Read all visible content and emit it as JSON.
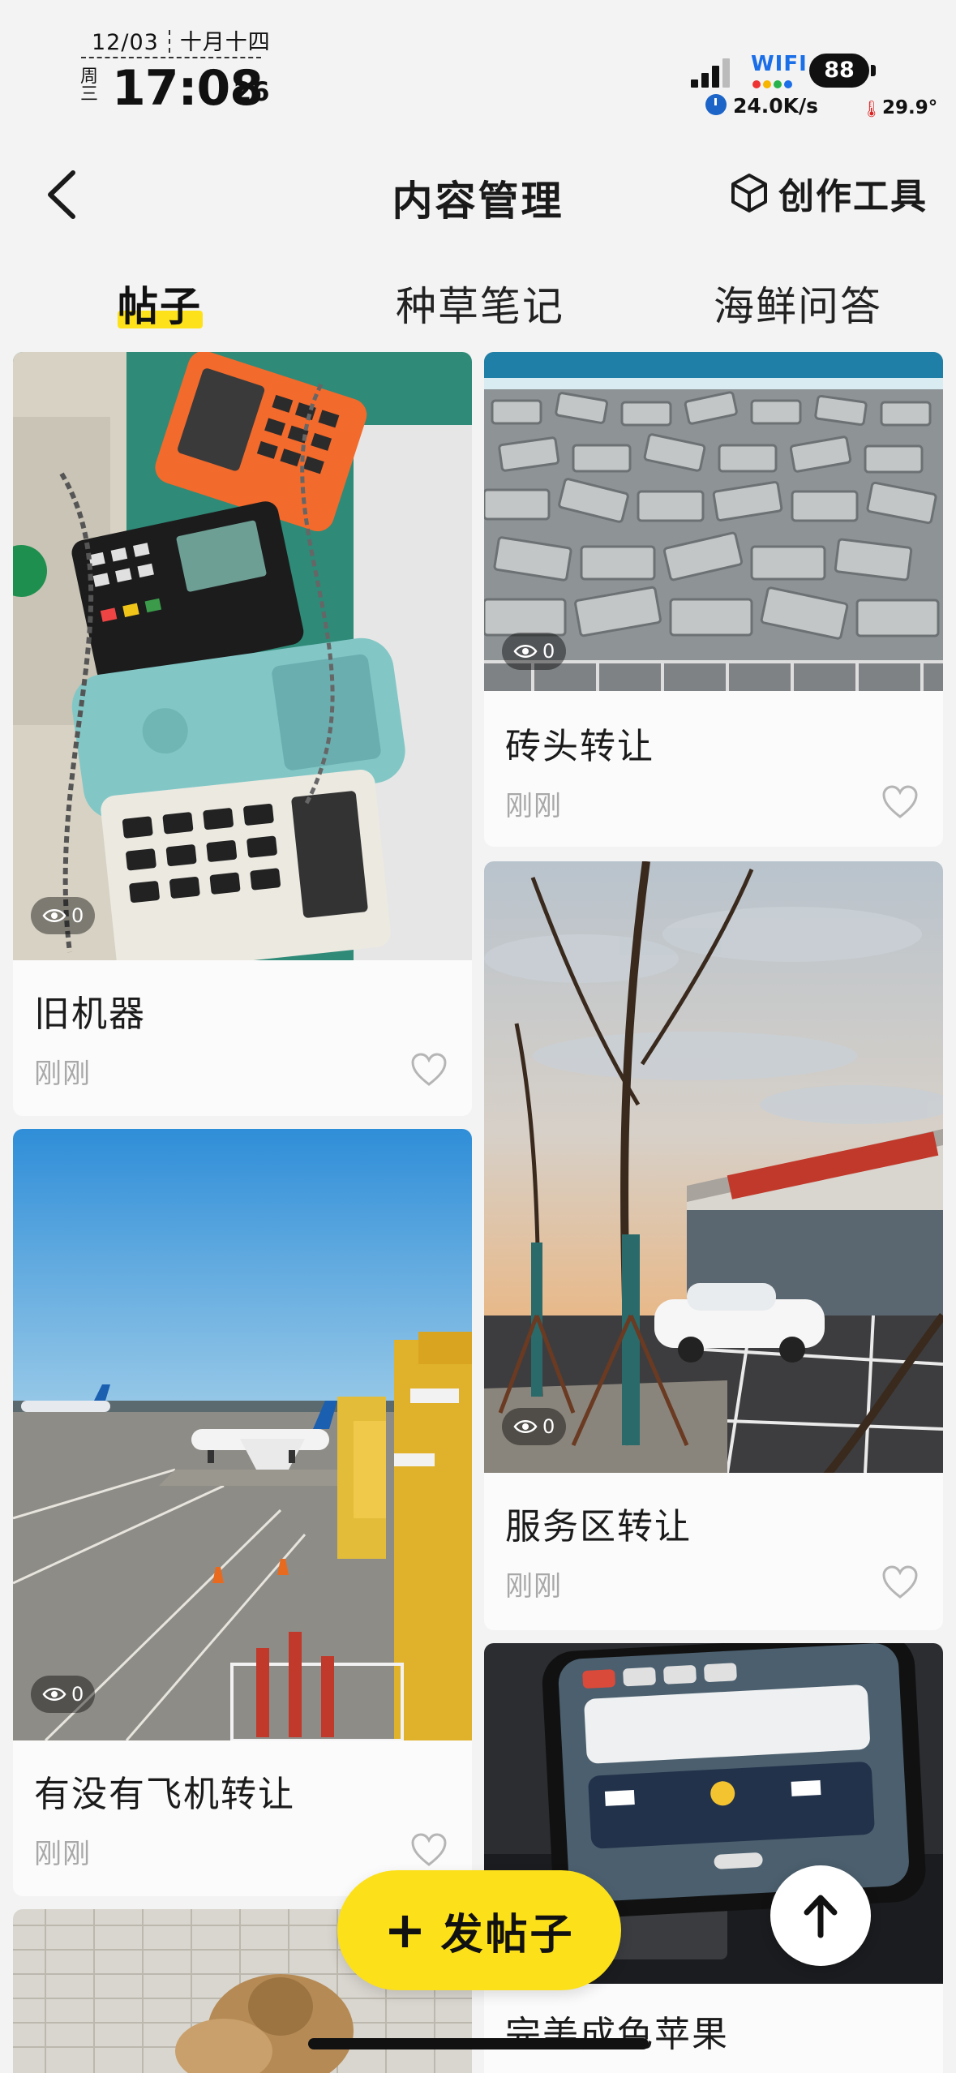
{
  "status_bar": {
    "date": "12/03",
    "lunar": "十月十四",
    "weekday": "周三",
    "time": "17:08",
    "seconds": "26",
    "wifi_label": "WIFI",
    "battery": "88",
    "net_speed": "24.0K/s",
    "temperature": "29.9°"
  },
  "header": {
    "title": "内容管理",
    "tools_label": "创作工具",
    "back_icon": "chevron-left-icon",
    "tools_icon": "cube-icon"
  },
  "tabs": [
    {
      "label": "帖子",
      "active": true
    },
    {
      "label": "种草笔记",
      "active": false
    },
    {
      "label": "海鲜问答",
      "active": false
    }
  ],
  "posts": [
    {
      "title": "旧机器",
      "time": "刚刚",
      "views": "0",
      "image": "old card machines"
    },
    {
      "title": "砖头转让",
      "time": "刚刚",
      "views": "0",
      "image": "concrete blocks"
    },
    {
      "title": "服务区转让",
      "time": "刚刚",
      "views": "0",
      "image": "service area"
    },
    {
      "title": "有没有飞机转让",
      "time": "刚刚",
      "views": "0",
      "image": "airport apron"
    },
    {
      "title": "完美成色苹果",
      "time": "",
      "views": "",
      "image": "phone"
    }
  ],
  "fab": {
    "label": "发帖子",
    "icon": "plus-icon"
  },
  "scroll_top_icon": "arrow-up-icon",
  "colors": {
    "accent": "#fde21b",
    "background": "#f3f3f3",
    "muted_text": "#a8a8a8"
  }
}
